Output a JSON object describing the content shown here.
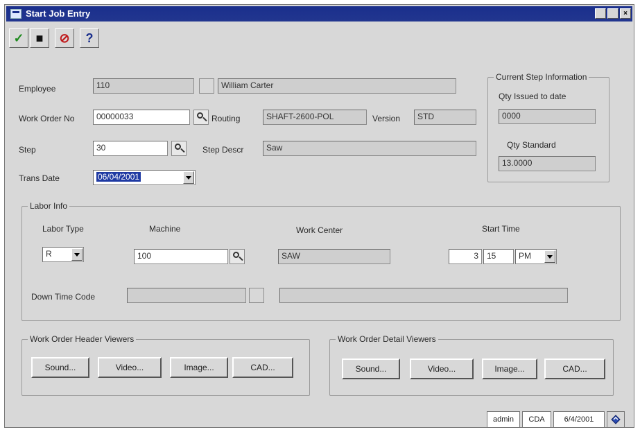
{
  "window": {
    "title": "Start Job Entry"
  },
  "toolbar": {
    "ok_glyph": "✓",
    "save_glyph": "■",
    "cancel_glyph": "⊘",
    "help_glyph": "?"
  },
  "employee": {
    "label": "Employee",
    "id": "110",
    "name": "William Carter"
  },
  "work_order": {
    "label": "Work Order No",
    "value": "00000033"
  },
  "routing": {
    "label": "Routing",
    "value": "SHAFT-2600-POL"
  },
  "version": {
    "label": "Version",
    "value": "STD"
  },
  "step": {
    "label": "Step",
    "value": "30"
  },
  "step_descr": {
    "label": "Step Descr",
    "value": "Saw"
  },
  "trans_date": {
    "label": "Trans Date",
    "value": "06/04/2001"
  },
  "current_step": {
    "title": "Current Step Information",
    "qty_issued_label": "Qty Issued to date",
    "qty_issued_value": "0000",
    "qty_standard_label": "Qty Standard",
    "qty_standard_value": "13.0000"
  },
  "labor": {
    "title": "Labor Info",
    "labor_type_label": "Labor Type",
    "labor_type_value": "R",
    "machine_label": "Machine",
    "machine_value": "100",
    "work_center_label": "Work Center",
    "work_center_value": "SAW",
    "start_time_label": "Start Time",
    "hour": "3",
    "minute": "15",
    "ampm": "PM",
    "down_time_label": "Down Time Code"
  },
  "header_viewers": {
    "title": "Work Order Header Viewers",
    "buttons": [
      "Sound...",
      "Video...",
      "Image...",
      "CAD..."
    ]
  },
  "detail_viewers": {
    "title": "Work Order Detail Viewers",
    "buttons": [
      "Sound...",
      "Video...",
      "Image...",
      "CAD..."
    ]
  },
  "statusbar": {
    "user": "admin",
    "company": "CDA",
    "date": "6/4/2001"
  },
  "colors": {
    "titlebar": "#1a2f8c",
    "selection": "#1f3aa3",
    "face": "#d8d8d8"
  }
}
